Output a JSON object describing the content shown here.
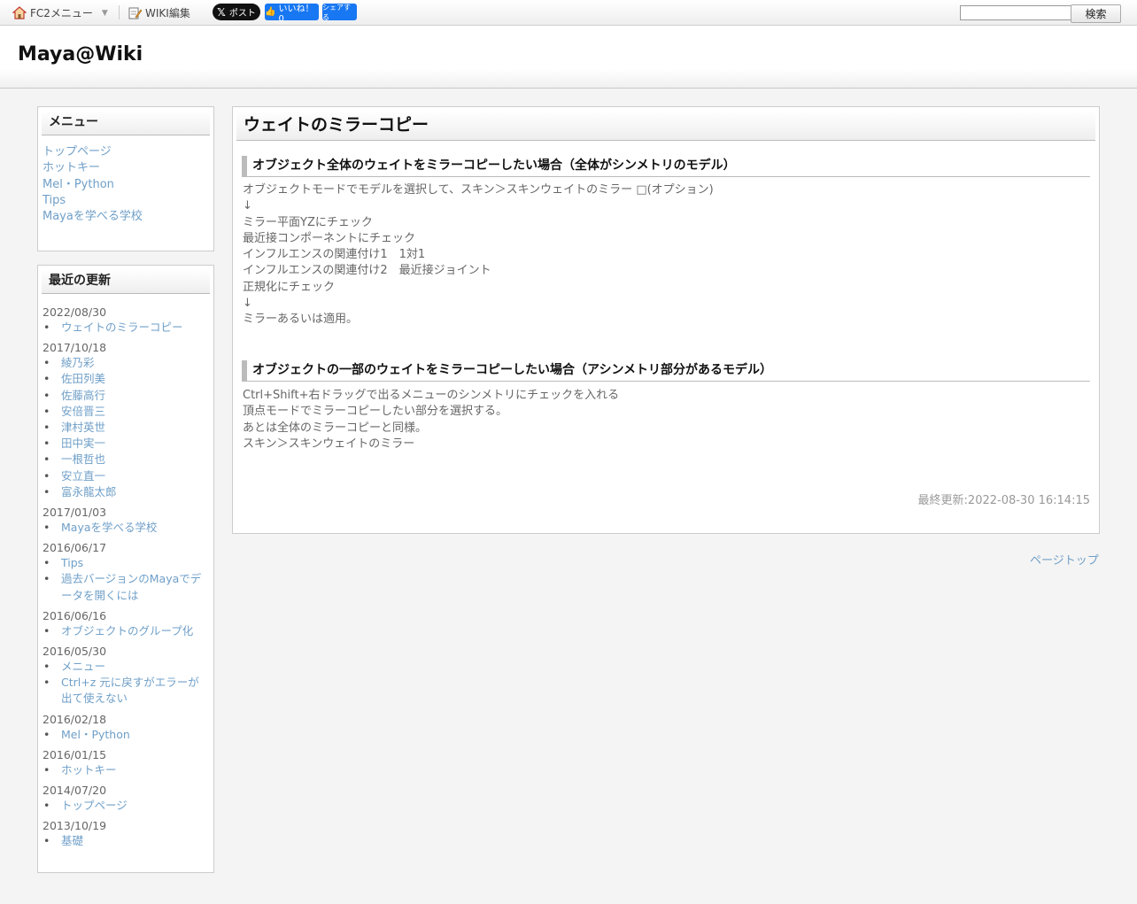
{
  "topbar": {
    "fc2_menu": "FC2メニュー",
    "wiki_edit": "WIKI編集",
    "x_button": "ポスト",
    "fb_like": "いいね！ 0",
    "fb_share": "シェアする",
    "search_placeholder": "",
    "search_button": "検索"
  },
  "header": {
    "site_title": "Maya@Wiki"
  },
  "menu": {
    "title": "メニュー",
    "items": [
      "トップページ",
      "ホットキー",
      "Mel・Python",
      "Tips",
      "Mayaを学べる学校"
    ]
  },
  "recent": {
    "title": "最近の更新",
    "groups": [
      {
        "date": "2022/08/30",
        "items": [
          "ウェイトのミラーコピー"
        ]
      },
      {
        "date": "2017/10/18",
        "items": [
          "綾乃彩",
          "佐田列美",
          "佐藤高行",
          "安倍晋三",
          "津村英世",
          "田中実一",
          "一根哲也",
          "安立直一",
          "富永龍太郎"
        ]
      },
      {
        "date": "2017/01/03",
        "items": [
          "Mayaを学べる学校"
        ]
      },
      {
        "date": "2016/06/17",
        "items": [
          "Tips",
          "過去バージョンのMayaでデータを開くには"
        ]
      },
      {
        "date": "2016/06/16",
        "items": [
          "オブジェクトのグループ化"
        ]
      },
      {
        "date": "2016/05/30",
        "items": [
          "メニュー",
          "Ctrl+z 元に戻すがエラーが出て使えない"
        ]
      },
      {
        "date": "2016/02/18",
        "items": [
          "Mel・Python"
        ]
      },
      {
        "date": "2016/01/15",
        "items": [
          "ホットキー"
        ]
      },
      {
        "date": "2014/07/20",
        "items": [
          "トップページ"
        ]
      },
      {
        "date": "2013/10/19",
        "items": [
          "基礎"
        ]
      }
    ]
  },
  "article": {
    "title": "ウェイトのミラーコピー",
    "sections": [
      {
        "heading": "オブジェクト全体のウェイトをミラーコピーしたい場合（全体がシンメトリのモデル）",
        "lines": [
          "オブジェクトモードでモデルを選択して、スキン＞スキンウェイトのミラー □(オプション)",
          "↓",
          "ミラー平面YZにチェック",
          "最近接コンポーネントにチェック",
          "インフルエンスの関連付け1　1対1",
          "インフルエンスの関連付け2　最近接ジョイント",
          "正規化にチェック",
          "↓",
          "ミラーあるいは適用。"
        ]
      },
      {
        "heading": "オブジェクトの一部のウェイトをミラーコピーしたい場合（アシンメトリ部分があるモデル）",
        "lines": [
          "Ctrl+Shift+右ドラッグで出るメニューのシンメトリにチェックを入れる",
          "頂点モードでミラーコピーしたい部分を選択する。",
          "あとは全体のミラーコピーと同様。",
          "スキン＞スキンウェイトのミラー"
        ]
      }
    ],
    "last_updated": "最終更新:2022-08-30 16:14:15"
  },
  "footer": {
    "page_top": "ページトップ"
  }
}
